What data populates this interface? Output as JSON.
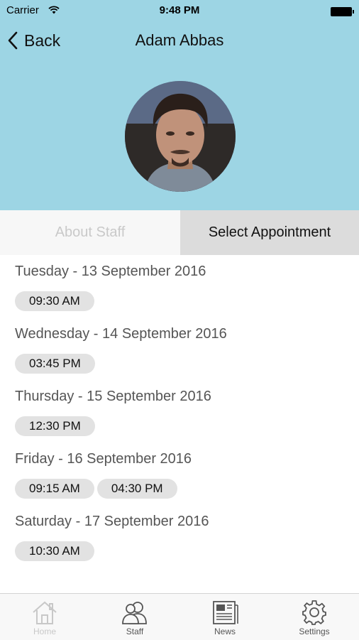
{
  "status_bar": {
    "carrier": "Carrier",
    "time": "9:48 PM"
  },
  "nav": {
    "back_label": "Back",
    "title": "Adam Abbas"
  },
  "tabs": [
    {
      "label": "About Staff",
      "selected": false
    },
    {
      "label": "Select Appointment",
      "selected": true
    }
  ],
  "days": [
    {
      "label": "Tuesday - 13 September 2016",
      "slots": [
        "09:30 AM"
      ]
    },
    {
      "label": "Wednesday - 14 September 2016",
      "slots": [
        "03:45 PM"
      ]
    },
    {
      "label": "Thursday - 15 September 2016",
      "slots": [
        "12:30 PM"
      ]
    },
    {
      "label": "Friday - 16 September 2016",
      "slots": [
        "09:15 AM",
        "04:30 PM"
      ]
    },
    {
      "label": "Saturday - 17 September 2016",
      "slots": [
        "10:30 AM"
      ]
    }
  ],
  "tabbar": [
    {
      "label": "Home",
      "icon": "home-icon",
      "active": false
    },
    {
      "label": "Staff",
      "icon": "staff-icon",
      "active": true
    },
    {
      "label": "News",
      "icon": "news-icon",
      "active": true
    },
    {
      "label": "Settings",
      "icon": "gear-icon",
      "active": true
    }
  ],
  "colors": {
    "header_bg": "#9dd5e4",
    "slot_bg": "#e2e2e2",
    "selected_tab_bg": "#dcdcdc"
  }
}
